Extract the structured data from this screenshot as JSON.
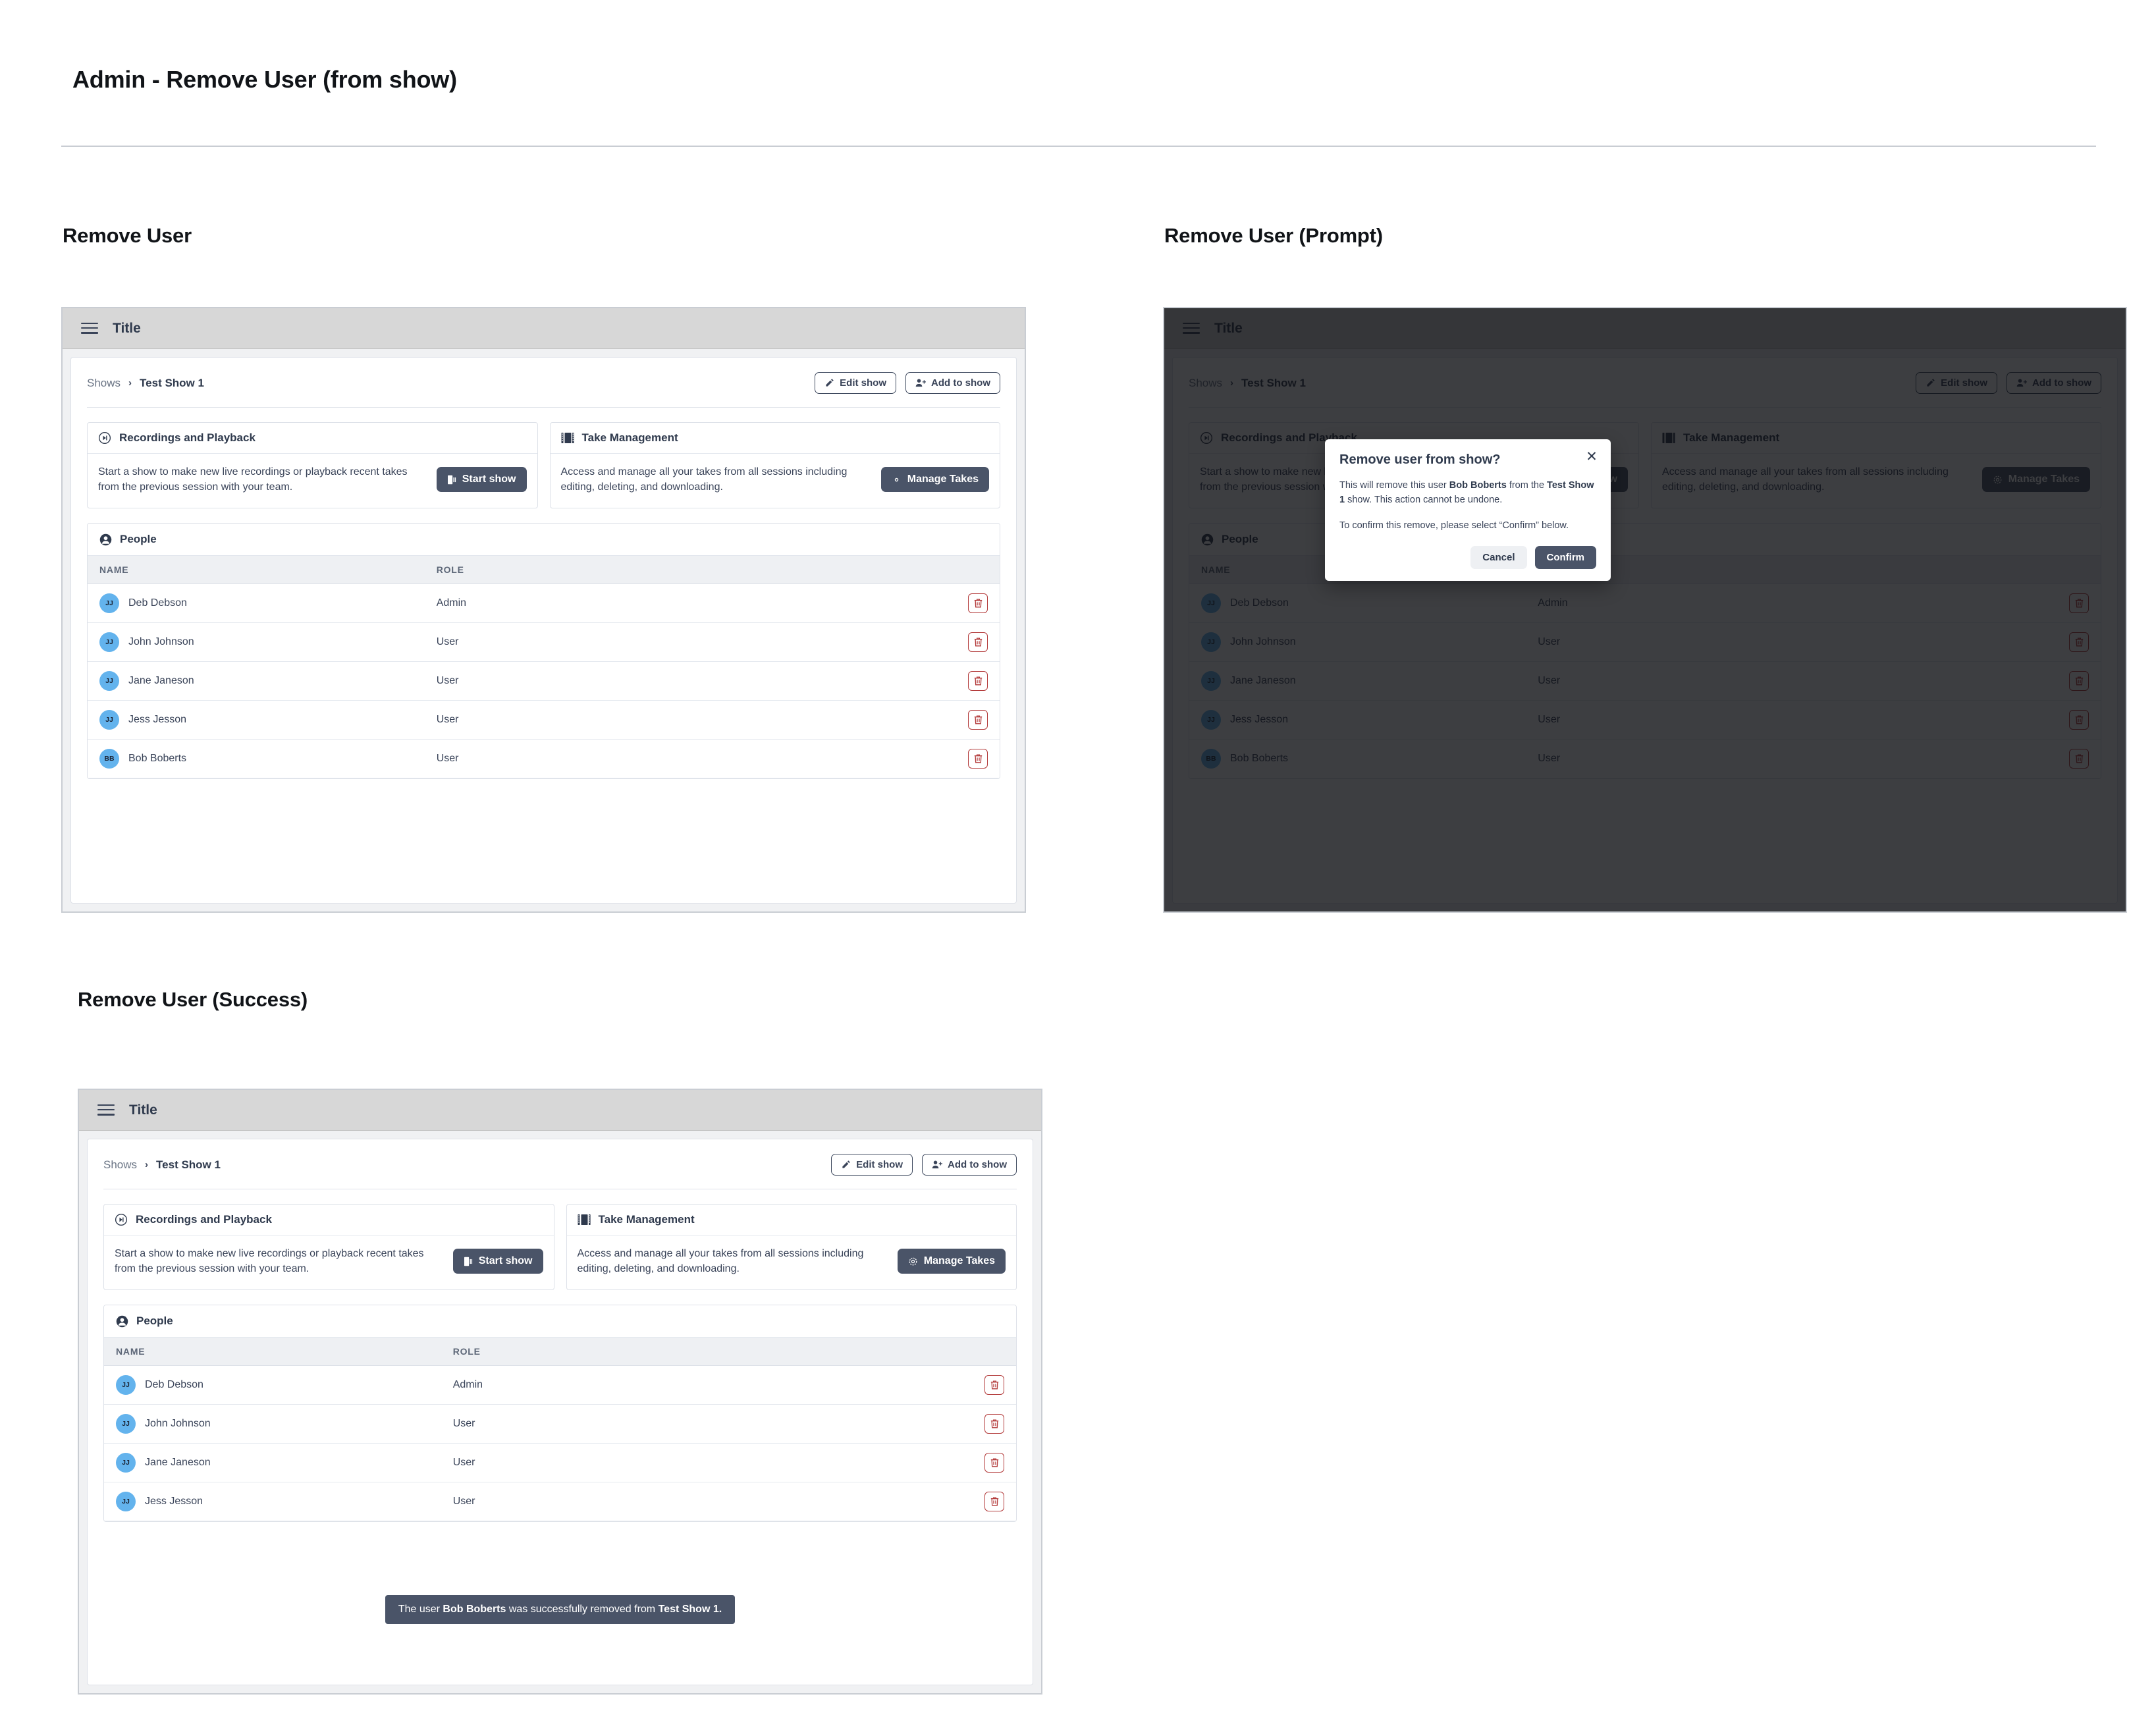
{
  "page": {
    "title": "Admin - Remove User (from show)"
  },
  "sections": {
    "remove": "Remove User",
    "prompt": "Remove User (Prompt)",
    "success": "Remove User (Success)"
  },
  "app": {
    "appbar_title": "Title",
    "menu_icon": "hamburger-menu-icon",
    "breadcrumb": {
      "root": "Shows",
      "separator": "›",
      "current": "Test Show 1"
    },
    "actions": {
      "edit_show": "Edit show",
      "edit_show_icon": "pencil-icon",
      "add_to_show": "Add to show",
      "add_to_show_icon": "user-plus-icon"
    },
    "cards": [
      {
        "title": "Recordings and Playback",
        "icon": "skip-forward-circle-icon",
        "body": "Start a show to make new live recordings or playback recent takes from the previous session with your team.",
        "button_label": "Start show",
        "button_icon": "door-enter-icon"
      },
      {
        "title": "Take Management",
        "icon": "film-strip-icon",
        "body": "Access and manage all your takes from all sessions including editing, deleting, and downloading.",
        "button_label": "Manage Takes",
        "button_icon": "gear-icon"
      }
    ],
    "people": {
      "title": "People",
      "icon": "person-circle-icon",
      "columns": [
        "NAME",
        "ROLE"
      ],
      "row_action_icon": "trash-icon",
      "rows_before": [
        {
          "initials": "JJ",
          "name": "Deb Debson",
          "role": "Admin"
        },
        {
          "initials": "JJ",
          "name": "John Johnson",
          "role": "User"
        },
        {
          "initials": "JJ",
          "name": "Jane Janeson",
          "role": "User"
        },
        {
          "initials": "JJ",
          "name": "Jess Jesson",
          "role": "User"
        },
        {
          "initials": "BB",
          "name": "Bob Boberts",
          "role": "User"
        }
      ],
      "rows_after": [
        {
          "initials": "JJ",
          "name": "Deb Debson",
          "role": "Admin"
        },
        {
          "initials": "JJ",
          "name": "John Johnson",
          "role": "User"
        },
        {
          "initials": "JJ",
          "name": "Jane Janeson",
          "role": "User"
        },
        {
          "initials": "JJ",
          "name": "Jess Jesson",
          "role": "User"
        }
      ]
    }
  },
  "modal": {
    "title": "Remove user from show?",
    "close_icon": "close-icon",
    "body_line1_pre": "This will remove this user ",
    "body_line1_user": "Bob Boberts",
    "body_line1_mid": " from the ",
    "body_line1_show": "Test Show 1",
    "body_line1_post": " show. This action cannot be undone.",
    "body_line2": "To confirm this remove, please select “Confirm” below.",
    "cancel_label": "Cancel",
    "confirm_label": "Confirm"
  },
  "toast": {
    "pre": "The user ",
    "user": "Bob Boberts",
    "mid": " was successfully removed from ",
    "show": "Test Show 1."
  },
  "colors": {
    "accent_dark": "#4a5468",
    "danger": "#b33a3a",
    "avatar": "#63b3ed",
    "appbar": "#d7d7d7",
    "canvas": "#f0f1f3"
  }
}
